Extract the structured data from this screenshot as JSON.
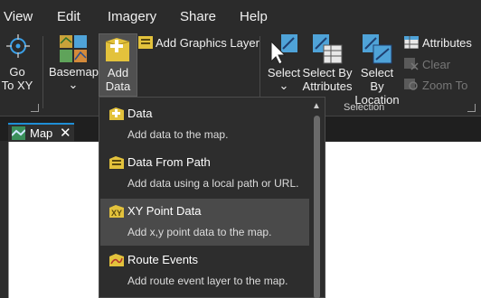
{
  "menu": {
    "tabs": [
      "View",
      "Edit",
      "Imagery",
      "Share",
      "Help"
    ]
  },
  "ribbon": {
    "go_to_xy": {
      "line1": "Go",
      "line2": "To XY"
    },
    "basemap": {
      "label": "Basemap",
      "caret": "⌄"
    },
    "add_data": {
      "line1": "Add",
      "line2": "Data",
      "caret": "⌄"
    },
    "add_graphics_layer": "Add Graphics Layer",
    "select": {
      "label": "Select",
      "caret": "⌄"
    },
    "select_by_attributes": {
      "line1": "Select By",
      "line2": "Attributes"
    },
    "select_by_location": {
      "line1": "Select By",
      "line2": "Location"
    },
    "attributes": "Attributes",
    "clear": "Clear",
    "zoom_to": "Zoom To",
    "selection_group_label": "Selection"
  },
  "map_tab": {
    "label": "Map",
    "close": "✕"
  },
  "dropdown": {
    "scroll_up": "▲",
    "items": [
      {
        "title": "Data",
        "description": "Add data to the map."
      },
      {
        "title": "Data From Path",
        "description": "Add data using a local path or URL."
      },
      {
        "title": "XY Point Data",
        "description": "Add x,y point data to the map.",
        "highlighted": true
      },
      {
        "title": "Route Events",
        "description": "Add route event layer to the map."
      }
    ]
  },
  "colors": {
    "background": "#2b2b2b",
    "accent_blue": "#1f8fd6",
    "add_data_yellow": "#e3c23c",
    "highlight": "#4a4a4a",
    "map_canvas": "#ffffff"
  },
  "icons": [
    "crosshair-icon",
    "basemap-grid-icon",
    "add-data-icon",
    "graphics-layer-icon",
    "select-cursor-icon",
    "select-by-attributes-icon",
    "select-by-location-icon",
    "attributes-table-icon",
    "clear-selection-icon",
    "zoom-to-selection-icon",
    "map-icon",
    "close-icon",
    "data-icon",
    "data-from-path-icon",
    "xy-point-data-icon",
    "route-events-icon"
  ]
}
